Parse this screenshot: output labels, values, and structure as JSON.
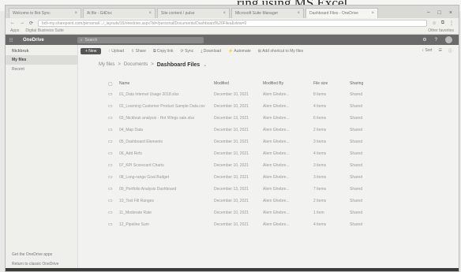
{
  "caption": "ring using MS Excel",
  "browser": {
    "tabs": [
      {
        "label": "Welcome to Bot Sync",
        "active": false
      },
      {
        "label": "Ai file - GitDoc",
        "active": false
      },
      {
        "label": "Site content / pulse",
        "active": false
      },
      {
        "label": "Microsoft Suite Manager",
        "active": false
      },
      {
        "label": "Dashboard Files - OneDrive",
        "active": true
      }
    ],
    "window_controls": [
      "−",
      "□",
      "×"
    ],
    "url": "bcit-my.sharepoint.com/personal/.../_layouts/15/onedrive.aspx?id=/personal/Documents/Dashboard%20Files&view=0",
    "bookmarks": [
      "Apps",
      "Digital Business Suite"
    ],
    "other_bookmarks": "Other favorites"
  },
  "appbar": {
    "brand": "OneDrive",
    "search_placeholder": "Search",
    "icons": [
      "settings-icon",
      "help-icon",
      "avatar"
    ]
  },
  "command_bar": {
    "new_label": "+ New",
    "items": [
      "↑ Upload",
      "⇪ Share",
      "⧉ Copy link",
      "⟳ Sync",
      "⤓ Download",
      "⚡ Automate",
      "⊞ Add shortcut to My files"
    ],
    "right_items": [
      "↕ Sort",
      "☰",
      "ⓘ"
    ]
  },
  "leftnav": {
    "owner": "Nickbruk",
    "items": [
      {
        "label": "My files",
        "active": true
      },
      {
        "label": "Recent",
        "active": false
      }
    ],
    "footer": [
      "Get the OneDrive apps",
      "Return to classic OneDrive"
    ]
  },
  "breadcrumb": {
    "parts": [
      "My files",
      ">",
      "Documents",
      ">"
    ],
    "current": "Dashboard Files",
    "chevron": "⌄"
  },
  "table": {
    "headers": [
      "Name",
      "Modified",
      "Modified By",
      "File size",
      "Sharing"
    ],
    "rows": [
      [
        "01_Data Internet Usage 2018.xlsx",
        "December 10, 2021",
        "Alem Ghebre...",
        "8 items",
        "Shared"
      ],
      [
        "02_Learning Customer Product Sample Data.csv",
        "December 10, 2021",
        "Alem Ghebre...",
        "4 items",
        "Shared"
      ],
      [
        "03_Nickbruk analysis - Hot Wings sale.xlsx",
        "December 13, 2021",
        "Alem Ghebre...",
        "6 items",
        "Shared"
      ],
      [
        "04_Map Data",
        "December 10, 2021",
        "Alem Ghebre...",
        "2 items",
        "Shared"
      ],
      [
        "05_Dashboard Elements",
        "December 10, 2021",
        "Alem Ghebre...",
        "3 items",
        "Shared"
      ],
      [
        "06_Add Refs",
        "December 10, 2021",
        "Alem Ghebre...",
        "4 items",
        "Shared"
      ],
      [
        "07_KPI Scorecard Charts",
        "December 10, 2021",
        "Alem Ghebre...",
        "3 items",
        "Shared"
      ],
      [
        "08_Long-range Goal Budget",
        "December 10, 2021",
        "Alem Ghebre...",
        "3 items",
        "Shared"
      ],
      [
        "09_Portfolio Analysis Dashboard",
        "December 13, 2021",
        "Alem Ghebre...",
        "7 items",
        "Shared"
      ],
      [
        "10_Tool Fill Ranges",
        "December 10, 2021",
        "Alem Ghebre...",
        "2 items",
        "Shared"
      ],
      [
        "11_Moderate Rate",
        "December 10, 2021",
        "Alem Ghebre...",
        "1 item",
        "Shared"
      ],
      [
        "12_Pipeline Sum",
        "December 10, 2021",
        "Alem Ghebre...",
        "4 items",
        "Shared"
      ]
    ]
  }
}
